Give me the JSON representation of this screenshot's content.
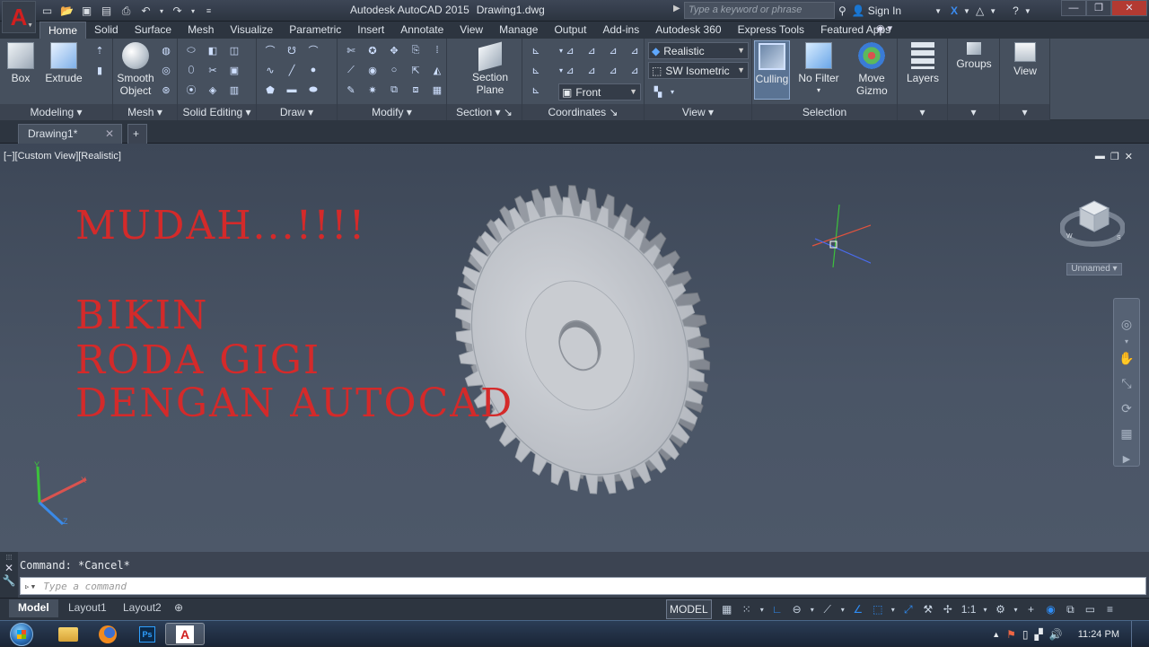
{
  "window": {
    "title": "Autodesk AutoCAD 2015",
    "file": "Drawing1.dwg",
    "search_placeholder": "Type a keyword or phrase",
    "sign_in": "Sign In"
  },
  "ribbon_tabs": [
    "Home",
    "Solid",
    "Surface",
    "Mesh",
    "Visualize",
    "Parametric",
    "Insert",
    "Annotate",
    "View",
    "Manage",
    "Output",
    "Add-ins",
    "Autodesk 360",
    "Express Tools",
    "Featured Apps"
  ],
  "ribbon": {
    "box": "Box",
    "extrude": "Extrude",
    "smooth_object": "Smooth Object",
    "section_plane": "Section Plane",
    "visual_style": "Realistic",
    "view_preset": "SW Isometric",
    "ucs_view": "Front",
    "culling": "Culling",
    "no_filter": "No Filter",
    "move_gizmo": "Move Gizmo",
    "layers": "Layers",
    "groups": "Groups",
    "view": "View",
    "panels": {
      "modeling": "Modeling",
      "mesh": "Mesh",
      "solid_editing": "Solid Editing",
      "draw": "Draw",
      "modify": "Modify",
      "section": "Section",
      "coordinates": "Coordinates",
      "view": "View",
      "selection": "Selection"
    }
  },
  "doc_tab": "Drawing1*",
  "viewport": {
    "label": "[−][Custom View][Realistic]",
    "unnamed": "Unnamed",
    "overlay_lines": [
      "MUDAH...!!!!",
      "BIKIN",
      "RODA GIGI",
      "DENGAN  AUTOCAD"
    ]
  },
  "command": {
    "history": "Command: *Cancel*",
    "placeholder": "Type a command"
  },
  "layout_tabs": [
    "Model",
    "Layout1",
    "Layout2"
  ],
  "status": {
    "model": "MODEL",
    "scale": "1:1"
  },
  "taskbar": {
    "clock": "11:24 PM"
  },
  "colors": {
    "accent_red": "#d42a2a",
    "autocad_red": "#d11f1f",
    "status_blue": "#2f8df5"
  },
  "icons": [
    "autocad-logo-icon",
    "new-icon",
    "open-icon",
    "save-icon",
    "saveas-icon",
    "print-icon",
    "undo-icon",
    "redo-icon",
    "search-icon",
    "user-icon",
    "exchange-icon",
    "help-icon",
    "box-icon",
    "extrude-icon",
    "smooth-object-icon",
    "section-plane-icon",
    "culling-icon",
    "no-filter-icon",
    "move-gizmo-icon",
    "layers-icon",
    "groups-icon",
    "view-icon",
    "viewcube-icon",
    "ucs-icon",
    "pan-icon",
    "zoom-icon",
    "orbit-icon",
    "windows-start-icon",
    "explorer-icon",
    "firefox-icon",
    "photoshop-icon",
    "autocad-taskbar-icon",
    "flag-icon",
    "network-icon",
    "volume-icon"
  ]
}
